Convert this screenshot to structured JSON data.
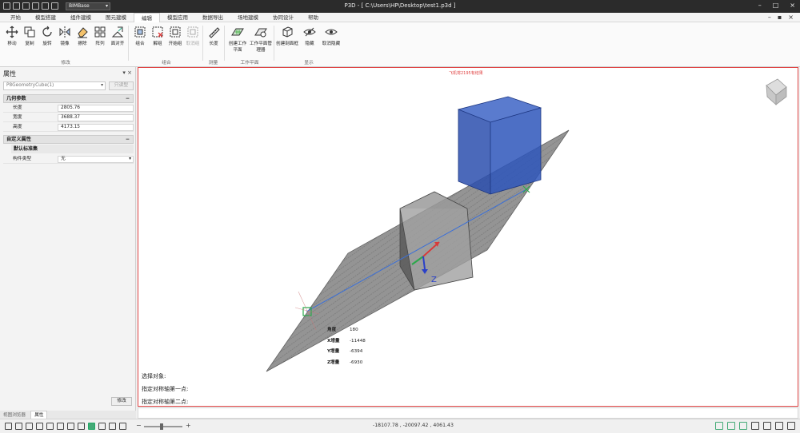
{
  "window": {
    "profile": "BIMBase",
    "title": "P3D - [ C:\\Users\\HP\\Desktop\\test1.p3d ]"
  },
  "menu": {
    "tabs": [
      "开始",
      "模型搭建",
      "组件建模",
      "图元建模",
      "编辑",
      "模型应用",
      "数据导出",
      "场地建模",
      "协同设计",
      "帮助"
    ],
    "active_index": 4
  },
  "ribbon": {
    "buttons": [
      "移动",
      "复制",
      "旋转",
      "镜像",
      "擦除",
      "阵列",
      "面对齐",
      "组合",
      "解组",
      "开始组",
      "取消组",
      "长度",
      "创建工作平面",
      "工作平面管理器",
      "创建剖面框",
      "隐藏",
      "取消隐藏"
    ],
    "groups": [
      "修改",
      "组合",
      "测量",
      "工作平面",
      "显示"
    ]
  },
  "properties": {
    "title": "属性",
    "pin": "▾",
    "close": "×",
    "object_type": "P8GeometryCube(1)",
    "edit_type": "只读型",
    "section_geometry": "几何参数",
    "length_label": "长度",
    "length_value": "2805.76",
    "width_label": "宽度",
    "width_value": "3688.37",
    "height_label": "高度",
    "height_value": "4173.15",
    "section_custom": "自定义属性",
    "subsection": "默认标准集",
    "component_type_label": "构件类型",
    "component_type_value": "无",
    "apply_button": "修改",
    "collapse": "−"
  },
  "bottom_tabs": [
    "视图浏览器",
    "属性"
  ],
  "viewport": {
    "hint": "飞机将2195有结果",
    "prompts": [
      "选择对象:",
      "指定对称轴第一点:",
      "指定对称轴第二点:"
    ],
    "measure": [
      {
        "label": "角度",
        "value": "180"
      },
      {
        "label": "X增量",
        "value": "-11448"
      },
      {
        "label": "Y增量",
        "value": "-6394"
      },
      {
        "label": "Z增量",
        "value": "-6930"
      }
    ],
    "axis_label_z": "Z"
  },
  "status": {
    "coords": "-18107.78 , -20097.42 , 4061.43",
    "zoom_minus": "−",
    "zoom_plus": "+"
  },
  "colors": {
    "viewport_border": "#e04545",
    "cube_blue": "#2b4fae",
    "axis_line": "#3a6fd8"
  }
}
